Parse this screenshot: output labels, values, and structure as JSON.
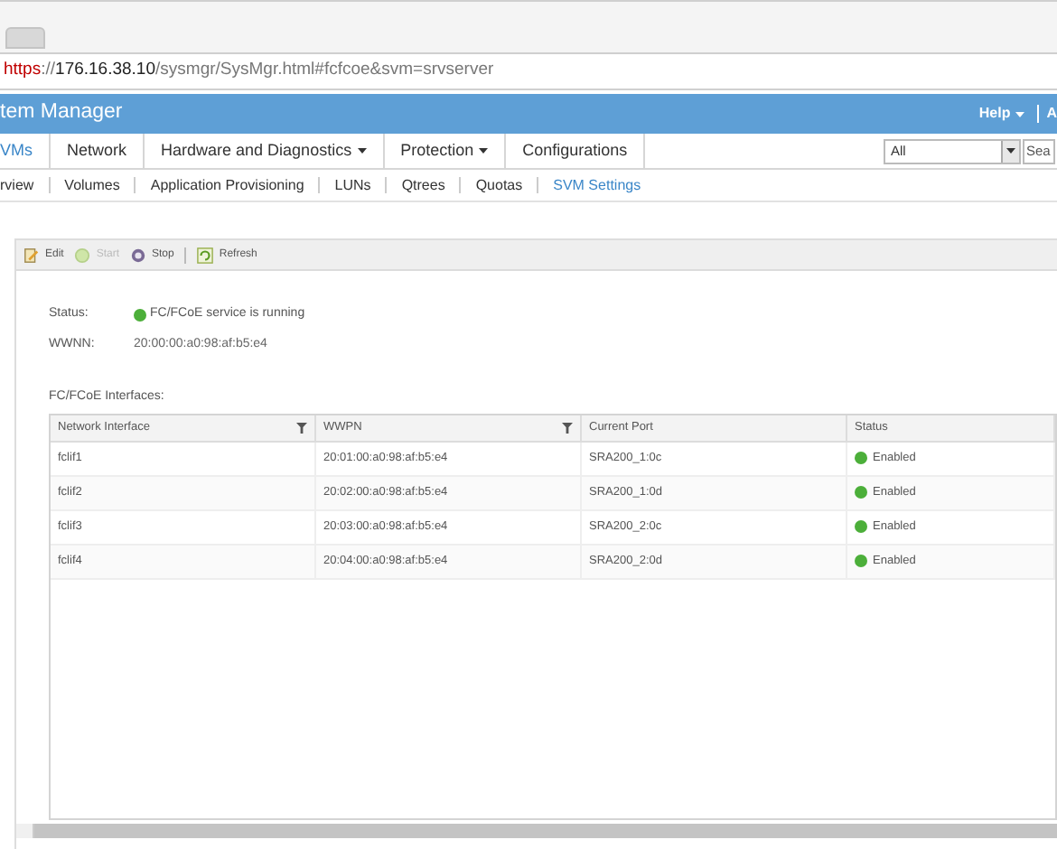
{
  "browser": {
    "url": {
      "protocol": "https",
      "insecure": true,
      "separator": "://",
      "host": "176.16.38.10",
      "path": "/sysmgr/SysMgr.html#fcfcoe&svm=srvserver"
    }
  },
  "header": {
    "title": "tem Manager",
    "help": "Help",
    "account": "A"
  },
  "nav": [
    {
      "label": "VMs",
      "selected": true,
      "menu": false
    },
    {
      "label": "Network",
      "selected": false,
      "menu": false
    },
    {
      "label": "Hardware and Diagnostics",
      "selected": false,
      "menu": true
    },
    {
      "label": "Protection",
      "selected": false,
      "menu": true
    },
    {
      "label": "Configurations",
      "selected": false,
      "menu": false
    }
  ],
  "search": {
    "scope": "All",
    "placeholder": "Sea"
  },
  "subnav": [
    {
      "label": "rview",
      "selected": false
    },
    {
      "label": "Volumes",
      "selected": false
    },
    {
      "label": "Application Provisioning",
      "selected": false
    },
    {
      "label": "LUNs",
      "selected": false
    },
    {
      "label": "Qtrees",
      "selected": false
    },
    {
      "label": "Quotas",
      "selected": false
    },
    {
      "label": "SVM Settings",
      "selected": true
    }
  ],
  "toolbar": [
    {
      "kind": "edit",
      "label": "Edit",
      "disabled": false
    },
    {
      "kind": "start",
      "label": "Start",
      "disabled": true
    },
    {
      "kind": "stop",
      "label": "Stop",
      "disabled": false
    },
    {
      "kind": "refresh",
      "label": "Refresh",
      "disabled": false
    }
  ],
  "details": [
    {
      "label": "Status:",
      "value": "FC/FCoE service is running",
      "ok": true
    },
    {
      "label": "WWNN:",
      "value": "20:00:00:a0:98:af:b5:e4",
      "ok": false
    }
  ],
  "table": {
    "title": "FC/FCoE Interfaces:",
    "columns": [
      {
        "label": "Network Interface",
        "filter": true
      },
      {
        "label": "WWPN",
        "filter": true
      },
      {
        "label": "Current Port",
        "filter": false
      },
      {
        "label": "Status",
        "filter": false
      }
    ],
    "rows": [
      [
        "fclif1",
        "20:01:00:a0:98:af:b5:e4",
        "SRA200_1:0c",
        "Enabled"
      ],
      [
        "fclif2",
        "20:02:00:a0:98:af:b5:e4",
        "SRA200_1:0d",
        "Enabled"
      ],
      [
        "fclif3",
        "20:03:00:a0:98:af:b5:e4",
        "SRA200_2:0c",
        "Enabled"
      ],
      [
        "fclif4",
        "20:04:00:a0:98:af:b5:e4",
        "SRA200_2:0d",
        "Enabled"
      ]
    ]
  }
}
